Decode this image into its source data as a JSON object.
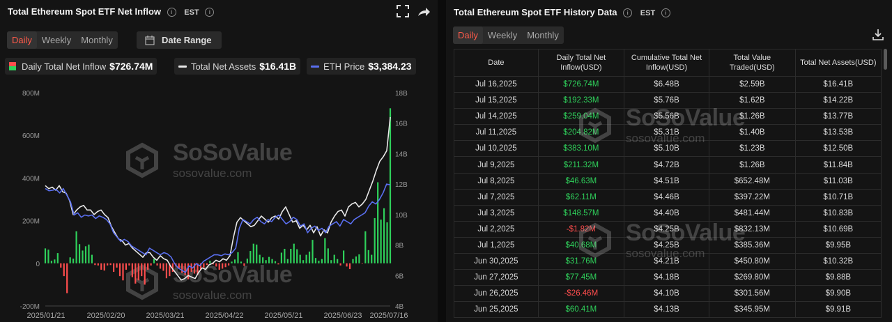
{
  "left": {
    "title": "Total Ethereum Spot ETF Net Inflow",
    "tz": "EST",
    "tabs": [
      "Daily",
      "Weekly",
      "Monthly"
    ],
    "date_range_label": "Date Range",
    "legend": {
      "inflow_label": "Daily Total Net Inflow",
      "inflow_value": "$726.74M",
      "assets_label": "Total Net Assets",
      "assets_value": "$16.41B",
      "price_label": "ETH Price",
      "price_value": "$3,384.23"
    },
    "watermark": {
      "name": "SoSoValue",
      "url": "sosovalue.com"
    }
  },
  "right": {
    "title": "Total Ethereum Spot ETF History Data",
    "tz": "EST",
    "tabs": [
      "Daily",
      "Weekly",
      "Monthly"
    ],
    "columns": [
      "Date",
      "Daily Total Net Inflow(USD)",
      "Cumulative Total Net Inflow(USD)",
      "Total Value Traded(USD)",
      "Total Net Assets(USD)"
    ],
    "rows": [
      [
        "Jul 16,2025",
        "$726.74M",
        "$6.48B",
        "$2.59B",
        "$16.41B"
      ],
      [
        "Jul 15,2025",
        "$192.33M",
        "$5.76B",
        "$1.62B",
        "$14.22B"
      ],
      [
        "Jul 14,2025",
        "$259.04M",
        "$5.56B",
        "$1.26B",
        "$13.77B"
      ],
      [
        "Jul 11,2025",
        "$204.82M",
        "$5.31B",
        "$1.40B",
        "$13.53B"
      ],
      [
        "Jul 10,2025",
        "$383.10M",
        "$5.10B",
        "$1.23B",
        "$12.50B"
      ],
      [
        "Jul 9,2025",
        "$211.32M",
        "$4.72B",
        "$1.26B",
        "$11.84B"
      ],
      [
        "Jul 8,2025",
        "$46.63M",
        "$4.51B",
        "$652.48M",
        "$11.03B"
      ],
      [
        "Jul 7,2025",
        "$62.11M",
        "$4.46B",
        "$397.22M",
        "$10.71B"
      ],
      [
        "Jul 3,2025",
        "$148.57M",
        "$4.40B",
        "$481.44M",
        "$10.83B"
      ],
      [
        "Jul 2,2025",
        "-$1.82M",
        "$4.25B",
        "$832.13M",
        "$10.69B"
      ],
      [
        "Jul 1,2025",
        "$40.68M",
        "$4.25B",
        "$385.36M",
        "$9.95B"
      ],
      [
        "Jun 30,2025",
        "$31.76M",
        "$4.21B",
        "$450.80M",
        "$10.32B"
      ],
      [
        "Jun 27,2025",
        "$77.45M",
        "$4.18B",
        "$269.80M",
        "$9.88B"
      ],
      [
        "Jun 26,2025",
        "-$26.46M",
        "$4.10B",
        "$301.56M",
        "$9.90B"
      ],
      [
        "Jun 25,2025",
        "$60.41M",
        "$4.13B",
        "$345.95M",
        "$9.91B"
      ]
    ],
    "watermark": {
      "name": "SoSoValue",
      "url": "sosovalue.com"
    }
  },
  "colors": {
    "positive": "#2fd15b",
    "negative": "#ff4d4d",
    "assets_line": "#e8e8e8",
    "price_line": "#5a6ff0",
    "accent": "#ff5a4a"
  },
  "chart_data": {
    "type": "bar",
    "title": "Total Ethereum Spot ETF Net Inflow",
    "y_left_ticks": [
      "800M",
      "600M",
      "400M",
      "200M",
      "0",
      "-200M"
    ],
    "y_left_range": [
      -200,
      800
    ],
    "y_left_unit": "M USD",
    "y_right_ticks": [
      "18B",
      "16B",
      "14B",
      "12B",
      "10B",
      "8B",
      "6B",
      "4B"
    ],
    "y_right_range": [
      4,
      18
    ],
    "y_right_unit": "B USD",
    "x_ticks": [
      "2025/01/21",
      "2025/02/20",
      "2025/03/21",
      "2025/04/22",
      "2025/05/21",
      "2025/06/23",
      "2025/07/16"
    ],
    "grid": false,
    "series": [
      {
        "name": "Daily Total Net Inflow",
        "type": "bar",
        "axis": "left",
        "values": [
          70,
          64,
          12,
          18,
          48,
          -20,
          -60,
          -140,
          28,
          22,
          150,
          90,
          60,
          80,
          88,
          40,
          -8,
          -10,
          -30,
          -34,
          -10,
          -8,
          -40,
          -20,
          -60,
          -80,
          -30,
          -10,
          -65,
          -95,
          -80,
          -60,
          -100,
          -30,
          -10,
          20,
          -10,
          -25,
          -35,
          -70,
          -60,
          -40,
          -15,
          -22,
          -45,
          -55,
          -75,
          -40,
          -48,
          -55,
          -30,
          -20,
          -8,
          12,
          -5,
          -15,
          -30,
          -25,
          -18,
          -10,
          8,
          18,
          52,
          8,
          -12,
          22,
          58,
          92,
          88,
          40,
          28,
          15,
          30,
          20,
          10,
          -5,
          50,
          68,
          20,
          68,
          92,
          66,
          40,
          15,
          40,
          55,
          110,
          25,
          12,
          20,
          118,
          70,
          15,
          40,
          20,
          -10,
          60,
          -15,
          -27,
          20,
          32,
          42,
          -2,
          150,
          62,
          40,
          212,
          380,
          205,
          258,
          192,
          727
        ]
      },
      {
        "name": "Total Net Assets",
        "type": "line",
        "axis": "right",
        "values": [
          11.9,
          11.7,
          11.8,
          11.6,
          11.9,
          11.5,
          11.4,
          10.9,
          10.0,
          10.3,
          10.5,
          10.6,
          10.3,
          10.3,
          10.0,
          10.2,
          10.3,
          10.0,
          9.8,
          9.2,
          8.8,
          8.4,
          8.3,
          8.0,
          8.1,
          7.8,
          7.6,
          7.4,
          7.2,
          7.5,
          7.5,
          7.2,
          7.0,
          7.3,
          7.1,
          7.0,
          6.6,
          6.3,
          6.0,
          5.7,
          5.8,
          6.0,
          5.9,
          5.8,
          6.2,
          6.5,
          6.4,
          6.7,
          6.8,
          7.0,
          6.9,
          7.1,
          7.0,
          7.3,
          8.5,
          9.5,
          9.8,
          9.6,
          9.4,
          9.2,
          9.3,
          9.6,
          9.9,
          9.7,
          9.5,
          9.8,
          9.9,
          9.7,
          10.2,
          10.5,
          10.0,
          9.5,
          9.6,
          9.1,
          9.3,
          9.0,
          9.3,
          8.8,
          9.2,
          8.6,
          9.0,
          8.8,
          9.5,
          9.9,
          10.2,
          10.3,
          9.9,
          10.5,
          10.7,
          10.8,
          10.5,
          10.7,
          11.0,
          11.6,
          12.2,
          12.9,
          13.5,
          13.8,
          14.2,
          16.4
        ]
      },
      {
        "name": "ETH Price",
        "type": "line",
        "axis": "right",
        "values": [
          3300,
          3250,
          3260,
          3280,
          3200,
          3300,
          3150,
          3000,
          2700,
          2750,
          2650,
          2700,
          2680,
          2700,
          2620,
          2680,
          2650,
          2600,
          2500,
          2300,
          2200,
          2100,
          2150,
          2100,
          2000,
          1950,
          1900,
          1850,
          1800,
          1950,
          1900,
          1850,
          1800,
          1850,
          1820,
          1750,
          1600,
          1500,
          1450,
          1400,
          1550,
          1500,
          1600,
          1550,
          1650,
          1700,
          1750,
          1800,
          1800,
          1780,
          1820,
          1800,
          1850,
          1950,
          2400,
          2600,
          2550,
          2500,
          2600,
          2650,
          2550,
          2500,
          2600,
          2550,
          2650,
          2700,
          2600,
          2500,
          2550,
          2650,
          2600,
          2450,
          2500,
          2300,
          2400,
          2450,
          2350,
          2400,
          2300,
          2450,
          2500,
          2550,
          2450,
          2600,
          2550,
          2500,
          2600,
          2650,
          2700,
          2750,
          2900,
          3000,
          2950,
          3050,
          3200,
          3400,
          3384
        ]
      }
    ]
  }
}
